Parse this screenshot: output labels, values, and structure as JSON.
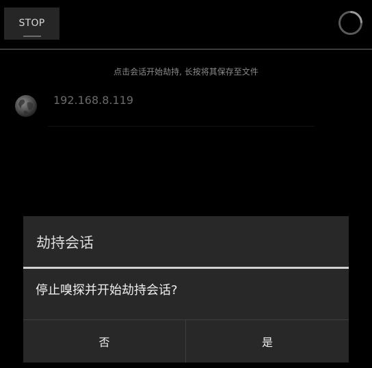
{
  "header": {
    "stop_label": "STOP"
  },
  "hint": "点击会话开始劫持, 长按将其保存至文件",
  "hosts": [
    {
      "ip": "192.168.8.119",
      "icon": "globe-icon"
    }
  ],
  "dialog": {
    "title": "劫持会话",
    "message": "停止嗅探并开始劫持会话?",
    "negative_label": "否",
    "positive_label": "是"
  },
  "colors": {
    "background": "#000000",
    "dialog_background": "#282828",
    "dialog_title_divider": "#d2d2d2"
  }
}
